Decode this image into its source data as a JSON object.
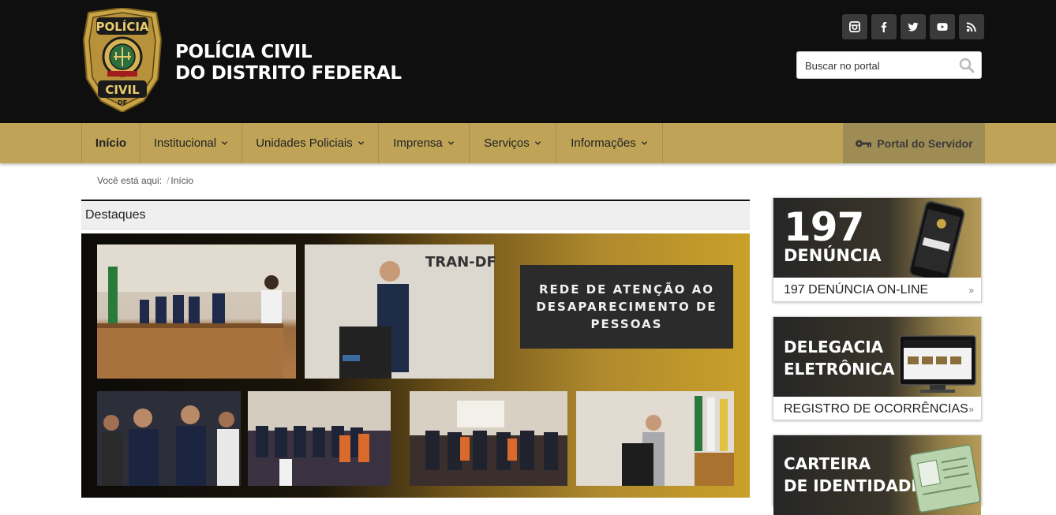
{
  "header": {
    "badge": {
      "top": "POLÍCIA",
      "bottom": "CIVIL",
      "state": "DF"
    },
    "brand_line1": "POLÍCIA CIVIL",
    "brand_line2": "DO DISTRITO FEDERAL",
    "social": [
      "instagram-icon",
      "facebook-icon",
      "twitter-icon",
      "youtube-icon",
      "rss-icon"
    ],
    "search_placeholder": "Buscar no portal"
  },
  "nav": {
    "items": [
      {
        "label": "Início"
      },
      {
        "label": "Institucional"
      },
      {
        "label": "Unidades Policiais"
      },
      {
        "label": "Imprensa"
      },
      {
        "label": "Serviços"
      },
      {
        "label": "Informações"
      }
    ],
    "portal_label": "Portal do Servidor"
  },
  "breadcrumb": {
    "prefix": "Você está aqui:",
    "current": "Início"
  },
  "main": {
    "section_title": "Destaques",
    "banner": {
      "caption": "REDE DE ATENÇÃO AO DESAPARECIMENTO DE PESSOAS",
      "wall_text": "TRAN-DF"
    }
  },
  "sidebar": {
    "cards": [
      {
        "big": "197",
        "sub": "DENÚNCIA",
        "footer": "197 DENÚNCIA ON-LINE"
      },
      {
        "title_line1": "DELEGACIA",
        "title_line2": "ELETRÔNICA",
        "footer": "REGISTRO DE OCORRÊNCIAS"
      },
      {
        "title_line1": "CARTEIRA",
        "title_line2": "DE IDENTIDADE"
      }
    ],
    "arrow": "»"
  },
  "colors": {
    "header_bg": "#0f0f0f",
    "nav_bg": "#bfa458",
    "portal_bg": "#9f8c54"
  }
}
